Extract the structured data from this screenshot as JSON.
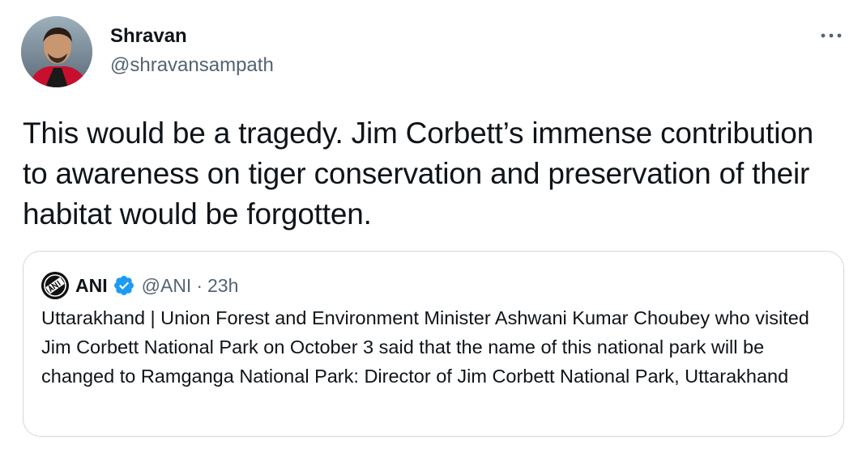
{
  "tweet": {
    "author": {
      "display_name": "Shravan",
      "handle": "@shravansampath",
      "avatar_icon": "user-photo-avatar"
    },
    "more_icon": "ellipsis-icon",
    "text": "This would be a tragedy. Jim Corbett’s immense contribution to awareness on tiger conservation and preservation of their habitat would be forgotten."
  },
  "quoted_tweet": {
    "author": {
      "display_name": "ANI",
      "handle": "@ANI",
      "avatar_icon": "ani-logo-avatar",
      "verified": true,
      "verified_color": "#1d9bf0"
    },
    "separator": "·",
    "time": "23h",
    "text": "Uttarakhand | Union Forest and Environment Minister Ashwani Kumar Choubey who visited Jim Corbett National Park on October 3 said that the name of this national park will be changed to Ramganga National Park: Director of Jim Corbett National Park, Uttarakhand"
  },
  "colors": {
    "text_primary": "#0f1419",
    "text_secondary": "#536471",
    "border": "#cfd9de",
    "verified_blue": "#1d9bf0"
  }
}
